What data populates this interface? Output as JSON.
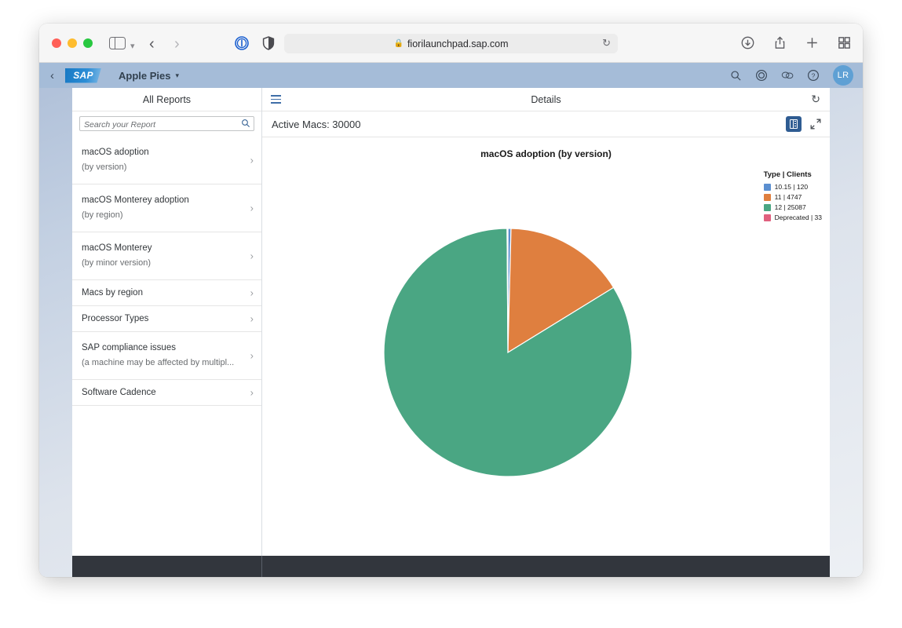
{
  "browser": {
    "url": "fiorilaunchpad.sap.com",
    "lock_icon": "lock-icon",
    "reload_icon": "reload-icon",
    "back_icon": "chevron-left-icon",
    "forward_icon": "chevron-right-icon",
    "sidebar_icon": "sidebar-toggle-icon",
    "tab_overview_icon": "tab-overview-icon",
    "downloads_icon": "downloads-icon",
    "share_icon": "share-icon",
    "new_tab_icon": "plus-icon"
  },
  "shell": {
    "back_label": "‹",
    "logo_text": "SAP",
    "app_title": "Apple Pies",
    "caret": "▾",
    "icons": [
      "search-icon",
      "target-icon",
      "chat-icon",
      "help-icon"
    ],
    "avatar_initials": "LR"
  },
  "master": {
    "header": "All Reports",
    "search": {
      "placeholder": "Search your Report",
      "value": "",
      "icon": "search-icon"
    },
    "items": [
      {
        "title": "macOS adoption",
        "subtitle": "(by version)",
        "two_line": true
      },
      {
        "title": "macOS Monterey adoption",
        "subtitle": "(by region)",
        "two_line": true
      },
      {
        "title": "macOS Monterey",
        "subtitle": "(by minor version)",
        "two_line": true
      },
      {
        "title": "Macs by region",
        "subtitle": "",
        "two_line": false
      },
      {
        "title": "Processor Types",
        "subtitle": "",
        "two_line": false
      },
      {
        "title": "SAP compliance issues",
        "subtitle": "(a machine may be affected by multipl...",
        "two_line": true
      },
      {
        "title": "Software Cadence",
        "subtitle": "",
        "two_line": false
      }
    ],
    "chevron": "›"
  },
  "detail": {
    "header": "Details",
    "menu_icon": "hamburger-icon",
    "refresh_icon": "refresh-icon",
    "summary": "Active Macs: 30000",
    "table_toggle_label": "table-view-icon",
    "expand_label": "fullscreen-icon"
  },
  "chart_data": {
    "type": "pie",
    "title": "macOS adoption (by version)",
    "legend_title": "Type | Clients",
    "legend_position": "right",
    "categories": [
      "10.15",
      "11",
      "12",
      "Deprecated"
    ],
    "values": [
      120,
      4747,
      25087,
      33
    ],
    "labels": [
      "10.15 | 120",
      "11 | 4747",
      "12 | 25087",
      "Deprecated | 33"
    ],
    "colors": [
      "#5b8fd0",
      "#df7f3f",
      "#4aa683",
      "#e0607e"
    ],
    "total": 29987,
    "start_angle": 0,
    "direction": "clockwise"
  },
  "colors": {
    "accent": "#2f5c92",
    "shellbar": "#a5bcd8",
    "footer": "#32363d"
  }
}
